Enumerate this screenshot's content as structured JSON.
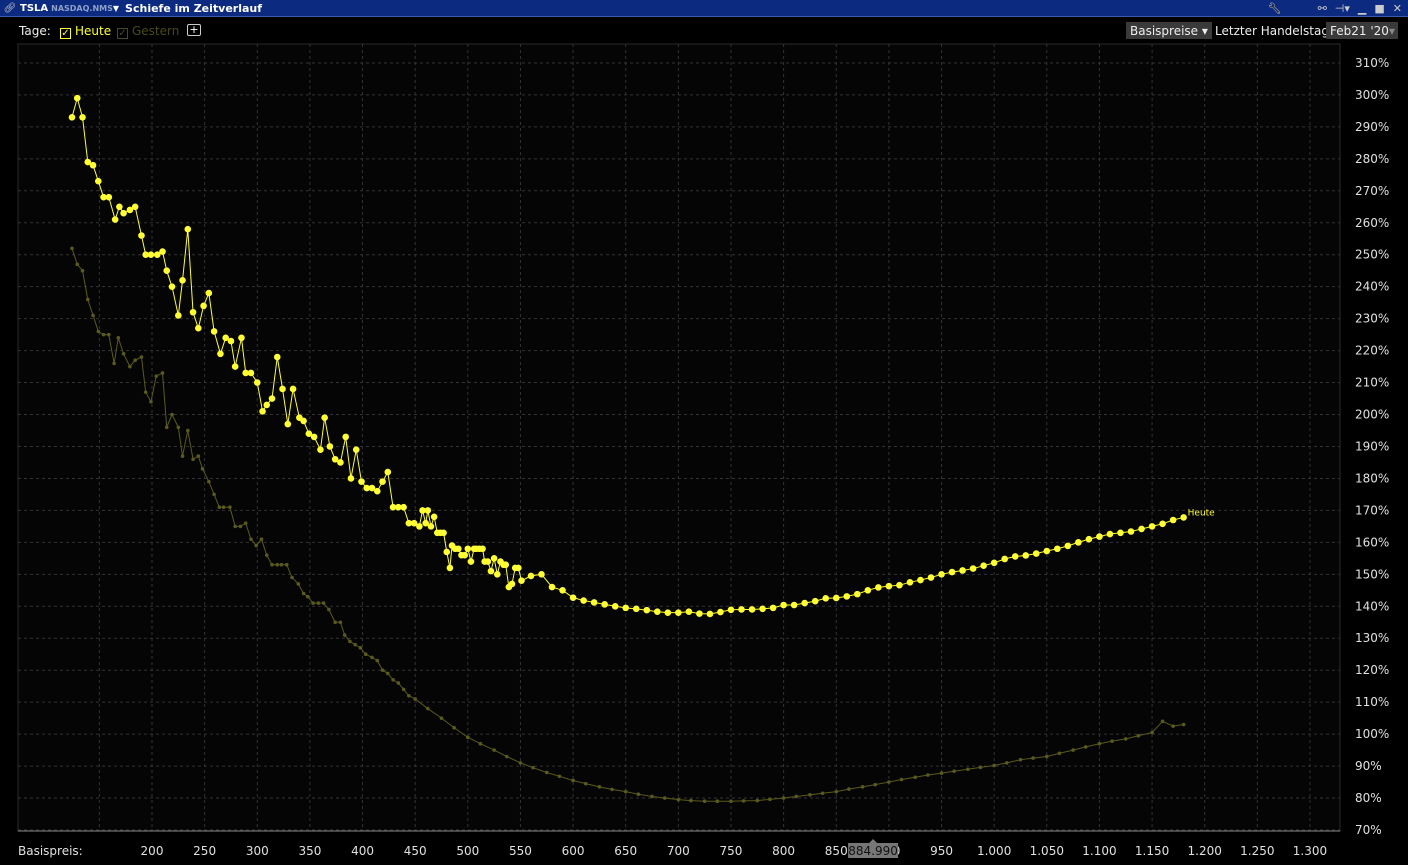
{
  "titlebar": {
    "symbol": "TSLA",
    "exchange": "NASDAQ.NMS",
    "title": "Schiefe im Zeitverlauf",
    "icons": [
      "link-icon",
      "wrench-icon",
      "chain-icon",
      "pin-icon",
      "minimize-icon",
      "maximize-icon",
      "close-icon"
    ]
  },
  "toolbar": {
    "days_label": "Tage:",
    "today": "Heute",
    "yesterday": "Gestern",
    "add": "+",
    "price_basis": "Basispreise",
    "last_trading_day_label": "Letzter Handelstag:",
    "last_trading_day": "Feb21 '20"
  },
  "colors": {
    "today": "#ffff33",
    "yesterday": "#5a5a1e",
    "title_bg": "#0b2a80"
  },
  "chart_data": {
    "type": "line",
    "xlabel": "Basispreis:",
    "x_ticks": [
      "200",
      "250",
      "300",
      "350",
      "400",
      "450",
      "500",
      "550",
      "600",
      "650",
      "700",
      "750",
      "800",
      "850",
      "900",
      "950",
      "1.000",
      "1.050",
      "1.100",
      "1.150",
      "1.200",
      "1.250",
      "1.300"
    ],
    "x_tick_values": [
      200,
      250,
      300,
      350,
      400,
      450,
      500,
      550,
      600,
      650,
      700,
      750,
      800,
      850,
      900,
      950,
      1000,
      1050,
      1100,
      1150,
      1200,
      1250,
      1300
    ],
    "y_ticks": [
      "70%",
      "80%",
      "90%",
      "100%",
      "110%",
      "120%",
      "130%",
      "140%",
      "150%",
      "160%",
      "170%",
      "180%",
      "190%",
      "200%",
      "210%",
      "220%",
      "230%",
      "240%",
      "250%",
      "260%",
      "270%",
      "280%",
      "290%",
      "300%",
      "310%"
    ],
    "xlim": [
      124,
      1300
    ],
    "ylim": [
      70,
      310
    ],
    "current_price_marker": "884.990",
    "series": [
      {
        "name": "Gestern",
        "x": [
          124,
          129,
          134,
          139,
          144,
          149,
          154,
          159,
          164,
          168,
          173,
          179,
          184,
          190,
          194,
          199,
          204,
          210,
          214,
          219,
          225,
          229,
          234,
          239,
          244,
          248,
          254,
          259,
          264,
          268,
          274,
          279,
          284,
          289,
          294,
          299,
          304,
          309,
          314,
          319,
          323,
          328,
          333,
          339,
          344,
          348,
          353,
          358,
          363,
          368,
          374,
          379,
          383,
          388,
          393,
          398,
          403,
          409,
          414,
          419,
          424,
          429,
          434,
          439,
          444,
          450,
          462,
          475,
          487,
          500,
          512,
          525,
          537,
          550,
          562,
          575,
          587,
          600,
          612,
          625,
          637,
          650,
          662,
          675,
          687,
          700,
          712,
          725,
          737,
          750,
          762,
          775,
          787,
          800,
          812,
          825,
          837,
          850,
          862,
          875,
          887,
          900,
          912,
          925,
          937,
          950,
          962,
          975,
          987,
          1000,
          1012,
          1025,
          1037,
          1050,
          1062,
          1075,
          1087,
          1100,
          1112,
          1125,
          1137,
          1150,
          1160,
          1170,
          1180
        ],
        "y": [
          252,
          247,
          245,
          236,
          231,
          226,
          225,
          225,
          216,
          224,
          219,
          215,
          217,
          218,
          207,
          204,
          212,
          213,
          196,
          200,
          196,
          187,
          195,
          186,
          187,
          183,
          179,
          175,
          171,
          171,
          171,
          165,
          165,
          166,
          161,
          159,
          161,
          156,
          153,
          153,
          153,
          153,
          149,
          147,
          144,
          143,
          141,
          141,
          141,
          139,
          135,
          135,
          131,
          129,
          128,
          127,
          125,
          124,
          123,
          120,
          119,
          117,
          116,
          114,
          112,
          111,
          108,
          105,
          102,
          99,
          97,
          95,
          93,
          91,
          89.5,
          88,
          86.8,
          85.5,
          84.5,
          83.5,
          82.7,
          82,
          81.2,
          80.5,
          80,
          79.5,
          79.2,
          79,
          79,
          79,
          79.1,
          79.2,
          79.6,
          80,
          80.5,
          81,
          81.5,
          82,
          82.8,
          83.5,
          84.2,
          85,
          85.8,
          86.5,
          87.2,
          87.8,
          88.4,
          89,
          89.6,
          90.2,
          91,
          92,
          92.5,
          93,
          94,
          95,
          96,
          97,
          97.8,
          98.5,
          99.5,
          100.5,
          104,
          102.5,
          103
        ]
      },
      {
        "name": "Heute",
        "x": [
          124,
          129,
          134,
          139,
          144,
          149,
          154,
          159,
          165,
          169,
          173,
          179,
          184,
          190,
          194,
          199,
          205,
          210,
          214,
          219,
          225,
          229,
          234,
          239,
          244,
          249,
          254,
          259,
          265,
          270,
          275,
          279,
          285,
          289,
          294,
          300,
          305,
          309,
          314,
          319,
          324,
          329,
          334,
          340,
          344,
          349,
          354,
          360,
          364,
          369,
          374,
          379,
          384,
          389,
          394,
          399,
          404,
          409,
          414,
          419,
          424,
          429,
          434,
          439,
          444,
          449,
          454,
          457,
          460,
          462,
          465,
          468,
          471,
          474,
          477,
          480,
          483,
          485,
          488,
          491,
          494,
          497,
          500,
          503,
          506,
          508,
          511,
          514,
          516,
          519,
          522,
          525,
          528,
          531,
          534,
          536,
          539,
          542,
          545,
          548,
          551,
          560,
          570,
          580,
          590,
          600,
          610,
          620,
          630,
          640,
          650,
          660,
          670,
          680,
          690,
          700,
          710,
          720,
          730,
          740,
          750,
          760,
          770,
          780,
          790,
          800,
          810,
          820,
          830,
          840,
          850,
          860,
          870,
          880,
          890,
          900,
          910,
          920,
          930,
          940,
          950,
          960,
          970,
          980,
          990,
          1000,
          1010,
          1020,
          1030,
          1040,
          1050,
          1060,
          1070,
          1080,
          1090,
          1100,
          1110,
          1120,
          1130,
          1140,
          1150,
          1160,
          1170,
          1180
        ],
        "y": [
          293,
          299,
          293,
          279,
          278,
          273,
          268,
          268,
          261,
          265,
          263,
          264,
          265,
          256,
          250,
          250,
          250,
          251,
          245,
          240,
          231,
          242,
          258,
          232,
          227,
          234,
          238,
          226,
          219,
          224,
          223,
          215,
          224,
          213,
          213,
          210,
          201,
          203,
          205,
          218,
          208,
          197,
          208,
          199,
          198,
          194,
          193,
          189,
          199,
          190,
          186,
          185,
          193,
          180,
          189,
          179,
          177,
          177,
          176,
          179,
          182,
          171,
          171,
          171,
          166,
          166,
          165,
          170,
          166,
          170,
          165,
          168,
          163,
          163,
          163,
          157,
          152,
          159,
          158,
          158,
          156,
          156,
          158,
          154,
          158,
          158,
          158,
          158,
          154,
          154,
          151,
          155,
          150,
          154,
          153,
          153,
          146,
          147,
          152,
          152,
          148,
          149.5,
          150,
          146,
          145,
          142.7,
          141.8,
          141.2,
          140.6,
          140,
          139.5,
          139.2,
          138.8,
          138.3,
          138,
          138,
          138.3,
          137.7,
          137.6,
          138.2,
          138.9,
          139,
          139,
          139.2,
          139.5,
          140.4,
          140.4,
          141,
          141.6,
          142.5,
          142.6,
          143.1,
          143.8,
          145,
          145.9,
          146.3,
          146.6,
          147.5,
          148.2,
          149,
          150,
          150.7,
          151.2,
          151.8,
          152.7,
          153.6,
          154.8,
          155.6,
          155.9,
          156.5,
          157.3,
          158,
          158.9,
          160,
          161,
          161.8,
          162.6,
          163,
          163.4,
          164.2,
          165,
          165.8,
          167,
          167.8
        ],
        "end_label": "Heute"
      }
    ]
  }
}
